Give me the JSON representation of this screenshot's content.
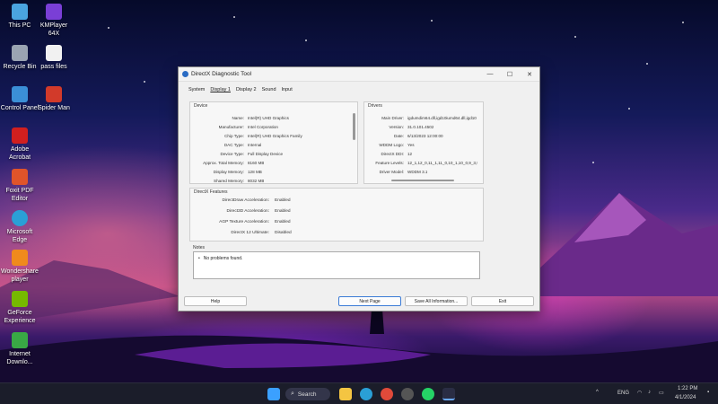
{
  "desktop_icons": [
    {
      "label": "This PC",
      "color": "#4aa3df"
    },
    {
      "label": "KMPlayer 64X",
      "color": "#7a3fd6"
    },
    {
      "label": "Recycle Bin",
      "color": "#9aa4b2"
    },
    {
      "label": "pass files",
      "color": "#f1f1f1"
    },
    {
      "label": "Control Panel",
      "color": "#3b8fd6"
    },
    {
      "label": "Spider Man",
      "color": "#d23a2a"
    },
    {
      "label": "Adobe Acrobat",
      "color": "#d11f1f"
    },
    {
      "label": "Foxit PDF Editor",
      "color": "#e0542a"
    },
    {
      "label": "Microsoft Edge",
      "color": "#2a9fd6"
    },
    {
      "label": "Wondershare player",
      "color": "#f08a1c"
    },
    {
      "label": "GeForce Experience",
      "color": "#76b900"
    },
    {
      "label": "Internet Downlo...",
      "color": "#39a845"
    }
  ],
  "window": {
    "title": "DirectX Diagnostic Tool",
    "controls": [
      "—",
      "☐",
      "✕"
    ],
    "tabs": [
      "System",
      "Display 1",
      "Display 2",
      "Sound",
      "Input"
    ],
    "active_tab": 1,
    "device": {
      "heading": "Device",
      "rows": [
        {
          "k": "Name:",
          "v": "Intel(R) UHD Graphics"
        },
        {
          "k": "Manufacturer:",
          "v": "Intel Corporation"
        },
        {
          "k": "Chip Type:",
          "v": "Intel(R) UHD Graphics Family"
        },
        {
          "k": "DAC Type:",
          "v": "Internal"
        },
        {
          "k": "Device Type:",
          "v": "Full Display Device"
        },
        {
          "k": "Approx. Total Memory:",
          "v": "8160 MB"
        },
        {
          "k": "Display Memory:",
          "v": "128 MB"
        },
        {
          "k": "Shared Memory:",
          "v": "8032 MB"
        }
      ]
    },
    "drivers": {
      "heading": "Drivers",
      "rows": [
        {
          "k": "Main Driver:",
          "v": "igdumdim64.dll,igd10iumd64.dll,igd10"
        },
        {
          "k": "Version:",
          "v": "31.0.101.4502"
        },
        {
          "k": "Date:",
          "v": "6/13/2023 12:00:00"
        },
        {
          "k": "WDDM Logo:",
          "v": "Yes"
        },
        {
          "k": "DirectX DDI:",
          "v": "12"
        },
        {
          "k": "Feature Levels:",
          "v": "12_1,12_0,11_1,11_0,10_1,10_0,9_3,9_2"
        },
        {
          "k": "Driver Model:",
          "v": "WDDM 3.1"
        }
      ]
    },
    "features": {
      "heading": "DirectX Features",
      "rows": [
        {
          "k": "DirectDraw Acceleration:",
          "v": "Enabled"
        },
        {
          "k": "Direct3D Acceleration:",
          "v": "Enabled"
        },
        {
          "k": "AGP Texture Acceleration:",
          "v": "Enabled"
        },
        {
          "k": "DirectX 12 Ultimate:",
          "v": "Disabled"
        }
      ]
    },
    "notes": {
      "heading": "Notes",
      "items": [
        "No problems found."
      ]
    },
    "buttons": {
      "help": "Help",
      "next_page": "Next Page",
      "save_all": "Save All Information...",
      "exit": "Exit"
    }
  },
  "taskbar": {
    "search_label": "Search",
    "language": "ENG",
    "time": "1:22 PM",
    "date": "4/1/2024"
  }
}
